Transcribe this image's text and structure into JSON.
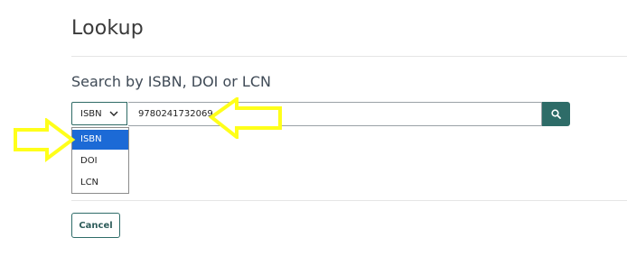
{
  "lookup": {
    "title": "Lookup",
    "subtitle": "Search by ISBN, DOI or LCN",
    "search_type": {
      "selected": "ISBN",
      "options": [
        "ISBN",
        "DOI",
        "LCN"
      ]
    },
    "search_value": "9780241732069",
    "search_icon": "magnifier-icon",
    "cancel_label": "Cancel"
  },
  "annotations": {
    "color": "#ffff1a",
    "icon": "arrow-icon"
  },
  "colors": {
    "accent": "#2e6c68",
    "selected_option": "#1c6ad6"
  }
}
